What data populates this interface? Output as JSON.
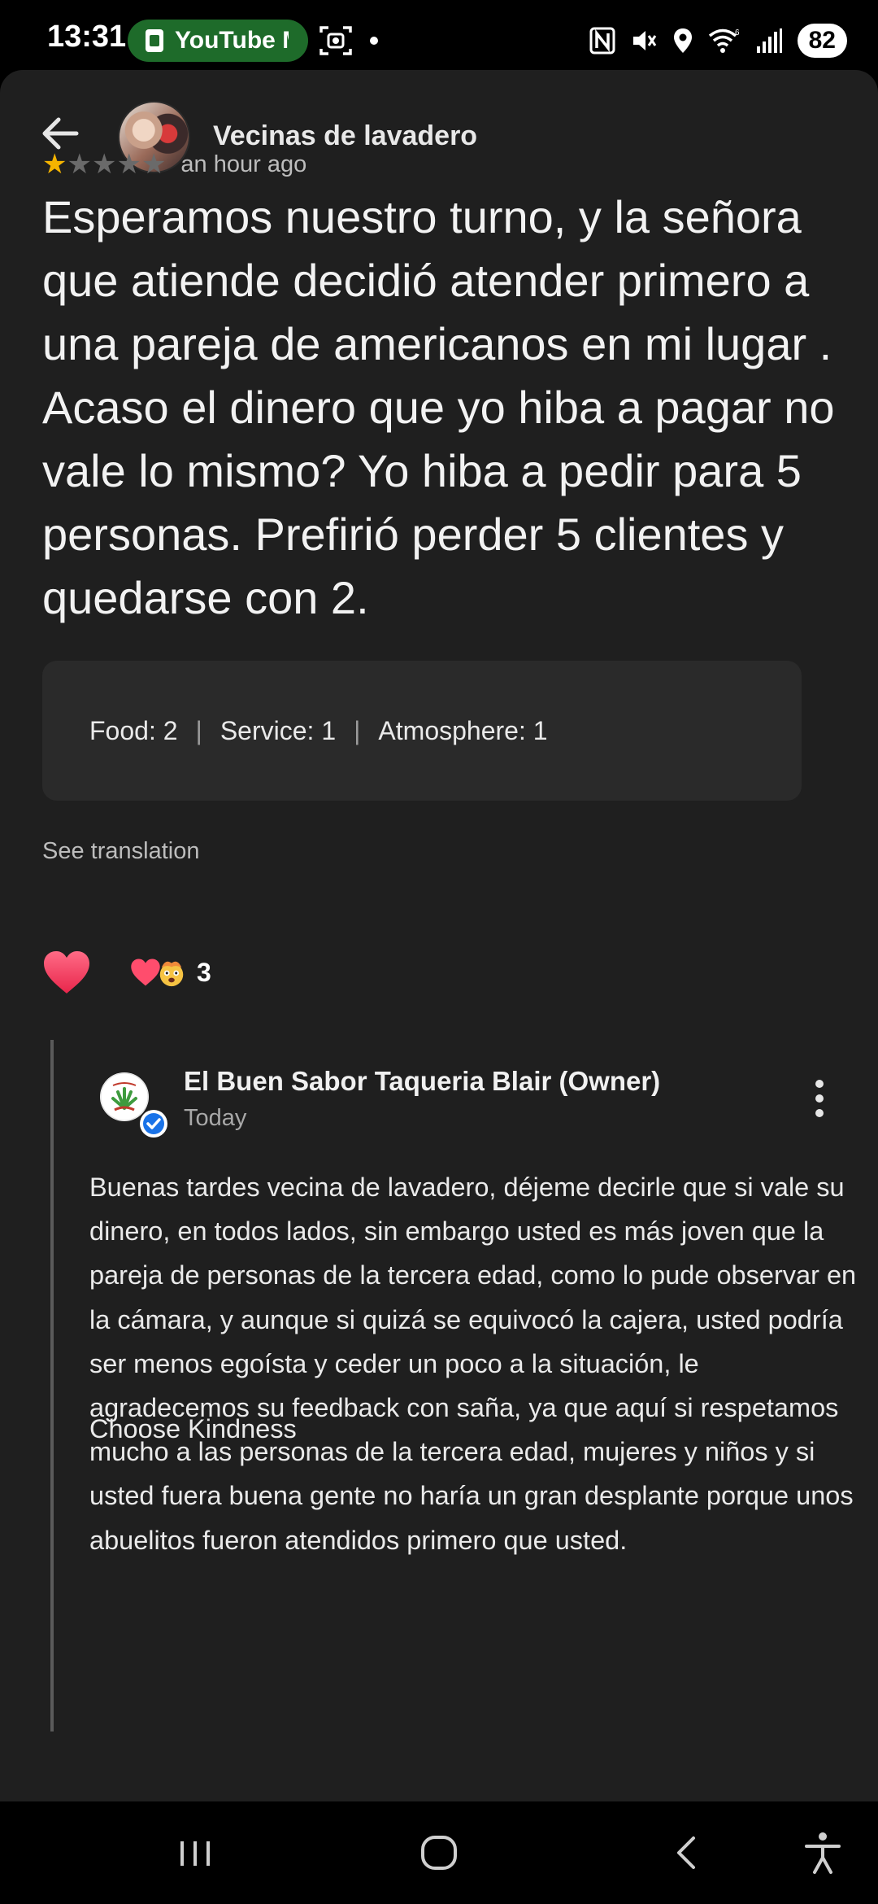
{
  "status_bar": {
    "time": "13:31",
    "pill_app": "YouTube M",
    "battery": "82",
    "icons": [
      "nfc-icon",
      "mute-icon",
      "location-icon",
      "wifi-icon",
      "signal-icon"
    ]
  },
  "header": {
    "reviewer_name": "Vecinas de lavadero"
  },
  "review": {
    "rating": 1,
    "max_rating": 5,
    "time": "an hour ago",
    "text": "Esperamos nuestro turno, y la señora que atiende decidió atender primero a una pareja de americanos en mi lugar . Acaso el dinero que yo hiba a pagar no vale lo mismo? Yo hiba a pedir para 5 personas. Prefirió perder 5 clientes y quedarse con 2.",
    "ratings": {
      "food": "Food: 2",
      "service": "Service: 1",
      "atmosphere": "Atmosphere: 1"
    },
    "see_translation": "See translation",
    "reaction_count": "3"
  },
  "owner_reply": {
    "name": "El Buen Sabor Taqueria Blair (Owner)",
    "time": "Today",
    "text": "Buenas tardes vecina de lavadero, déjeme decirle que si vale su dinero, en todos lados, sin embargo usted es más joven que la pareja de personas de la tercera edad, como lo pude observar en la cámara, y aunque si quizá se equivocó la cajera, usted podría ser menos egoísta y ceder un poco a la situación, le agradecemos su feedback con saña, ya que aquí si respetamos mucho a las personas de la tercera edad, mujeres y niños y si usted fuera buena gente no haría un gran desplante porque unos abuelitos fueron atendidos primero que usted.",
    "signoff": "Choose Kindness"
  },
  "colors": {
    "background": "#1f1f1f",
    "star_active": "#f5b400",
    "star_inactive": "#6a6a6a",
    "heart": "#ff4d6d",
    "verified": "#1a73e8"
  }
}
